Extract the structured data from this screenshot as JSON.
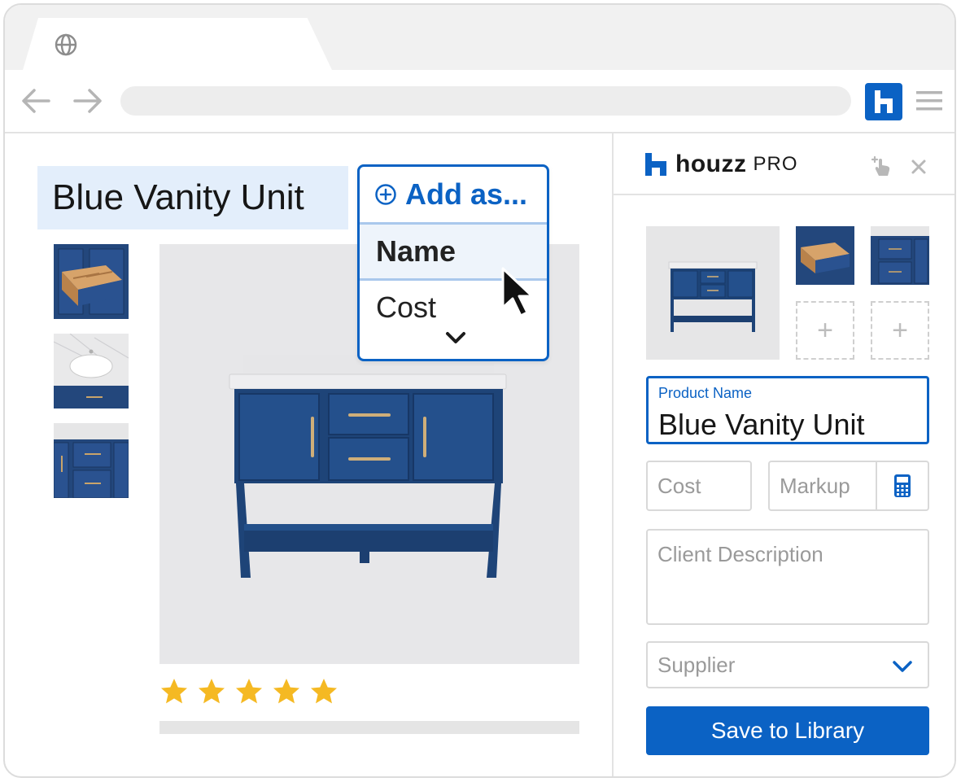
{
  "browser": {
    "icons": {
      "tab": "globe-icon",
      "back": "back-arrow-icon",
      "forward": "forward-arrow-icon",
      "extension": "houzz-logo-icon",
      "menu": "hamburger-menu-icon"
    }
  },
  "page": {
    "product_title": "Blue Vanity Unit",
    "rating": 5,
    "rating_max": 5
  },
  "popup": {
    "title": "Add as...",
    "items": [
      "Name",
      "Cost"
    ]
  },
  "panel": {
    "brand_name": "houzz",
    "brand_sub": "PRO",
    "product_name_label": "Product Name",
    "product_name_value": "Blue Vanity Unit",
    "cost_placeholder": "Cost",
    "markup_placeholder": "Markup",
    "description_placeholder": "Client Description",
    "supplier_placeholder": "Supplier",
    "save_label": "Save to Library"
  },
  "colors": {
    "accent": "#0b62c4",
    "title_highlight": "#e3eefb",
    "star": "#f5b923",
    "vanity_blue": "#1e4478"
  }
}
